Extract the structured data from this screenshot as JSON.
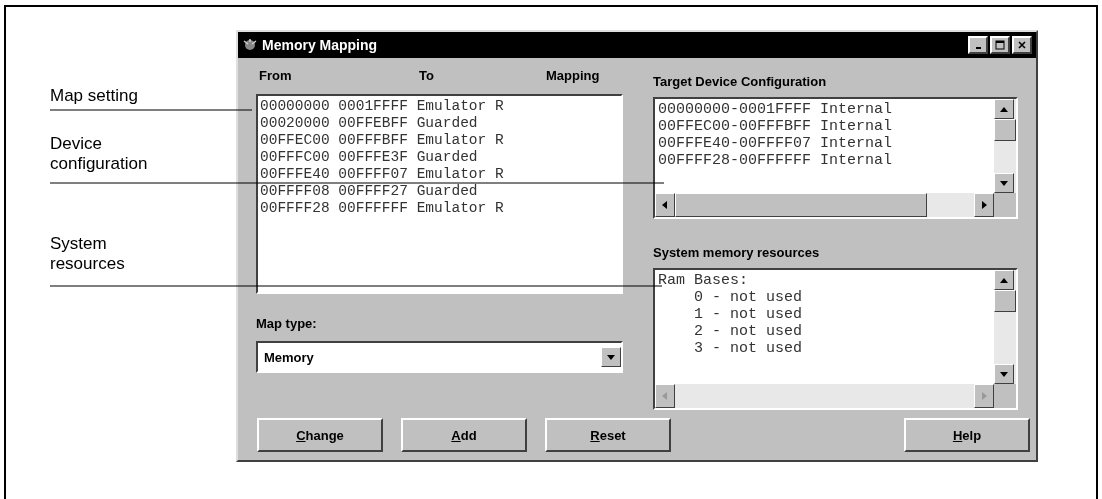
{
  "callouts": [
    {
      "text": "Map setting"
    },
    {
      "text": "Device configuration"
    },
    {
      "text": "System resources"
    }
  ],
  "window": {
    "title": "Memory Mapping"
  },
  "map_list": {
    "headers": [
      "From",
      "To",
      "Mapping"
    ],
    "lines": [
      "00000000 0001FFFF Emulator R",
      "00020000 00FFEBFF Guarded",
      "00FFEC00 00FFFBFF Emulator R",
      "00FFFC00 00FFFE3F Guarded",
      "00FFFE40 00FFFF07 Emulator R",
      "00FFFF08 00FFFF27 Guarded",
      "00FFFF28 00FFFFFF Emulator R"
    ]
  },
  "map_type": {
    "label": "Map type:",
    "value": "Memory"
  },
  "target_device": {
    "label": "Target Device Configuration",
    "h_scroll_disabled": false,
    "lines": [
      "00000000-0001FFFF Internal",
      "00FFEC00-00FFFBFF Internal",
      "00FFFE40-00FFFF07 Internal",
      "00FFFF28-00FFFFFF Internal"
    ]
  },
  "system_resources": {
    "label": "System memory resources",
    "h_scroll_disabled": true,
    "lines": [
      "Ram Bases:",
      "    0 - not used",
      "    1 - not used",
      "    2 - not used",
      "    3 - not used"
    ]
  },
  "buttons": [
    "Change",
    "Add",
    "Reset"
  ],
  "help_button": "Help"
}
